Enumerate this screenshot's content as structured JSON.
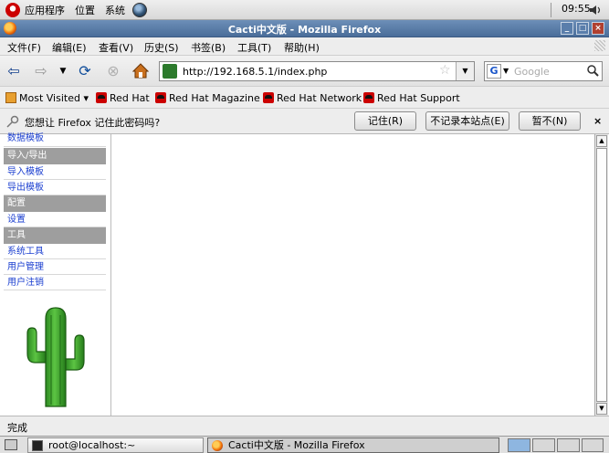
{
  "top_panel": {
    "menus": [
      "应用程序",
      "位置",
      "系统"
    ],
    "clock": "09:55"
  },
  "window": {
    "title": "Cacti中文版 - Mozilla Firefox",
    "controls": [
      "minimize-icon",
      "maximize-icon",
      "close-icon"
    ]
  },
  "menubar": {
    "items": [
      "文件(F)",
      "编辑(E)",
      "查看(V)",
      "历史(S)",
      "书签(B)",
      "工具(T)",
      "帮助(H)"
    ]
  },
  "navbar": {
    "url": "http://192.168.5.1/index.php",
    "search_placeholder": "Google"
  },
  "bookmarks": {
    "items": [
      "Most Visited",
      "Red Hat",
      "Red Hat Magazine",
      "Red Hat Network",
      "Red Hat Support"
    ]
  },
  "password_bar": {
    "message": "您想让 Firefox 记住此密码吗?",
    "remember": "记住(R)",
    "never": "不记录本站点(E)",
    "not_now": "暂不(N)",
    "close": "×"
  },
  "sidebar": {
    "data_template": "数据模板",
    "import_export": "导入/导出",
    "import_template": "导入模板",
    "export_template": "导出模板",
    "config": "配置",
    "settings": "设置",
    "tools": "工具",
    "system_tools": "系统工具",
    "user_management": "用户管理",
    "user_logout": "用户注销"
  },
  "status": {
    "text": "完成"
  },
  "taskbar": {
    "items": [
      "root@localhost:~",
      "Cacti中文版 - Mozilla Firefox"
    ]
  },
  "colors": {
    "titlebar": "#5478a5",
    "sidebar_header": "#9e9e9e",
    "sidebar_link": "#1b3fd0",
    "cactus_green": "#3fa52e"
  }
}
